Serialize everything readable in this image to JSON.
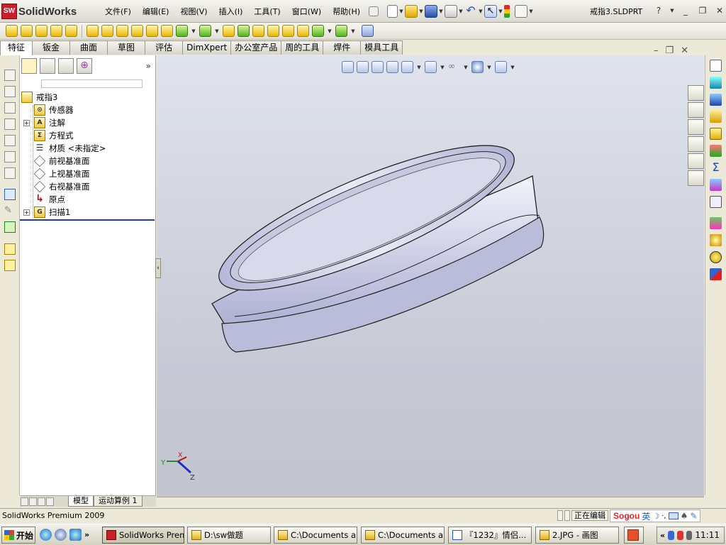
{
  "app": {
    "logo_text": "SolidWorks",
    "document_title": "戒指3.SLDPRT",
    "menus": [
      "文件(F)",
      "编辑(E)",
      "视图(V)",
      "插入(I)",
      "工具(T)",
      "窗口(W)",
      "帮助(H)"
    ],
    "window_controls": {
      "help": "?",
      "minimize": "_",
      "restore": "❐",
      "close": "✕"
    }
  },
  "command_tabs": [
    "特征",
    "钣金",
    "曲面",
    "草图",
    "评估",
    "DimXpert",
    "办公室产品",
    "周的工具",
    "焊件",
    "模具工具"
  ],
  "active_tab": "特征",
  "feature_tree": {
    "root": "戒指3",
    "items": [
      {
        "label": "传感器",
        "icon": "sensor-icon",
        "expandable": false
      },
      {
        "label": "注解",
        "icon": "annotation-icon",
        "expandable": true
      },
      {
        "label": "方程式",
        "icon": "equation-icon",
        "expandable": false
      },
      {
        "label": "材质 <未指定>",
        "icon": "material-icon",
        "expandable": false
      },
      {
        "label": "前视基准面",
        "icon": "plane-icon",
        "expandable": false
      },
      {
        "label": "上视基准面",
        "icon": "plane-icon",
        "expandable": false
      },
      {
        "label": "右视基准面",
        "icon": "plane-icon",
        "expandable": false
      },
      {
        "label": "原点",
        "icon": "origin-icon",
        "expandable": false
      },
      {
        "label": "扫描1",
        "icon": "sweep-icon",
        "expandable": true
      }
    ],
    "expand_toggle": "»"
  },
  "bottom_tabs": [
    "模型",
    "运动算例 1"
  ],
  "triad": {
    "y": "Y",
    "x": "X",
    "z": "Z"
  },
  "status": {
    "product": "SolidWorks Premium 2009",
    "editing": "正在编辑"
  },
  "ime": {
    "brand": "Sogou",
    "mode": "英"
  },
  "taskbar": {
    "start_label": "开始",
    "more": "»",
    "tasks": [
      {
        "label": "SolidWorks Prem...",
        "active": true
      },
      {
        "label": "D:\\sw做题",
        "active": false
      },
      {
        "label": "C:\\Documents a...",
        "active": false
      },
      {
        "label": "C:\\Documents a...",
        "active": false
      },
      {
        "label": "『1232』情侣...",
        "active": false
      },
      {
        "label": "2.JPG - 画图",
        "active": false
      }
    ],
    "tray_expand": "«",
    "clock": "11:11"
  }
}
